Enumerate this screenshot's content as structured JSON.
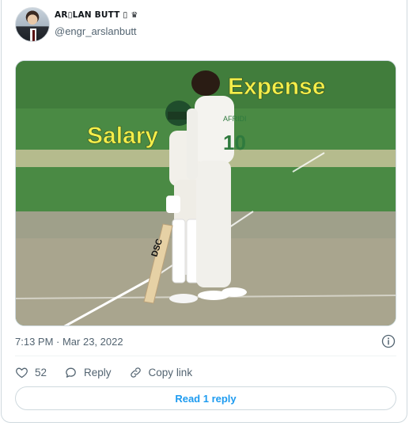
{
  "tweet": {
    "display_name": "AR▯LAN BUTT ▯",
    "crown_glyph": "♛",
    "handle": "@engr_arslanbutt",
    "timestamp": "7:13 PM · Mar 23, 2022",
    "media": {
      "overlay_left": "Salary",
      "overlay_right": "Expense",
      "overlay_color": "#f3ee4a",
      "jersey_text": "AFRIDI",
      "jersey_number": "10",
      "bat_text": "DSC"
    },
    "actions": {
      "like_icon": "heart-icon",
      "like_count": "52",
      "reply_icon": "speech-bubble-icon",
      "reply_label": "Reply",
      "copy_icon": "link-icon",
      "copy_label": "Copy link"
    },
    "read_replies_label": "Read 1 reply"
  },
  "colors": {
    "accent": "#1d9bf0",
    "muted_text": "#536471",
    "border": "#cfd9de"
  }
}
